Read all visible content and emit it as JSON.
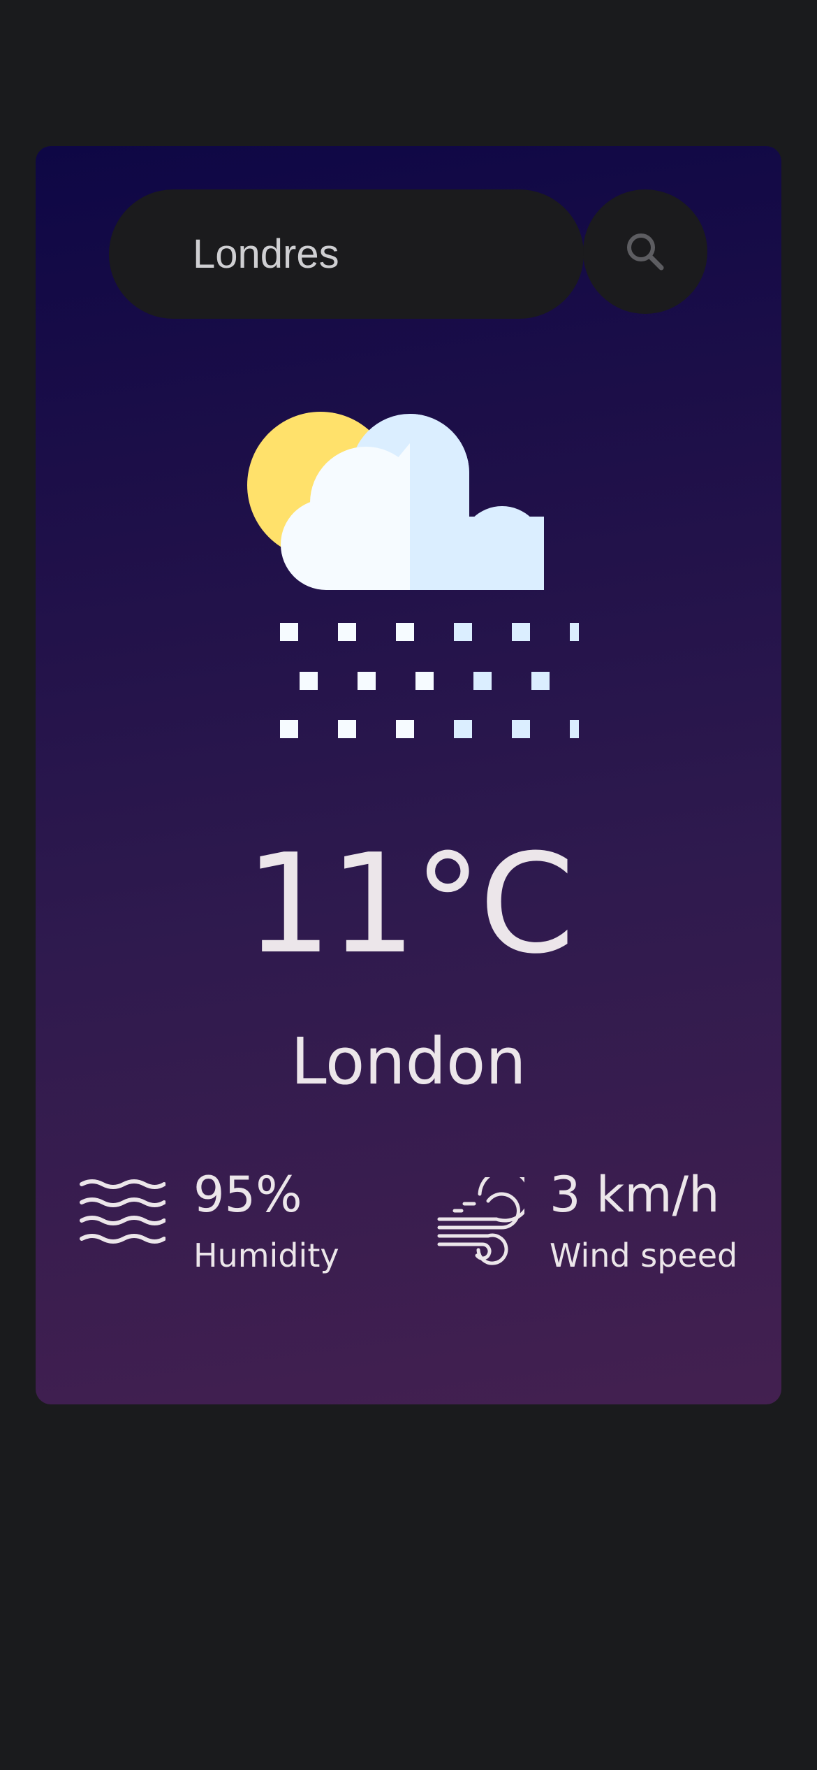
{
  "search": {
    "value": "Londres",
    "button_icon": "search-icon"
  },
  "weather": {
    "icon": "cloud-sun-snow-icon",
    "temperature": "11°C",
    "city": "London"
  },
  "stats": {
    "humidity": {
      "icon": "waves-icon",
      "value": "95%",
      "label": "Humidity"
    },
    "wind": {
      "icon": "wind-icon",
      "value": "3 km/h",
      "label": "Wind speed"
    }
  },
  "colors": {
    "page_background": "#1a1b1d",
    "card_gradient_top": "#0e0745",
    "card_gradient_bottom": "#432050",
    "text": "#ece6ea",
    "search_background": "#1b1b1d",
    "sun": "#ffe16b",
    "cloud_light": "#f6fbff",
    "cloud_shade": "#dbeeff"
  }
}
